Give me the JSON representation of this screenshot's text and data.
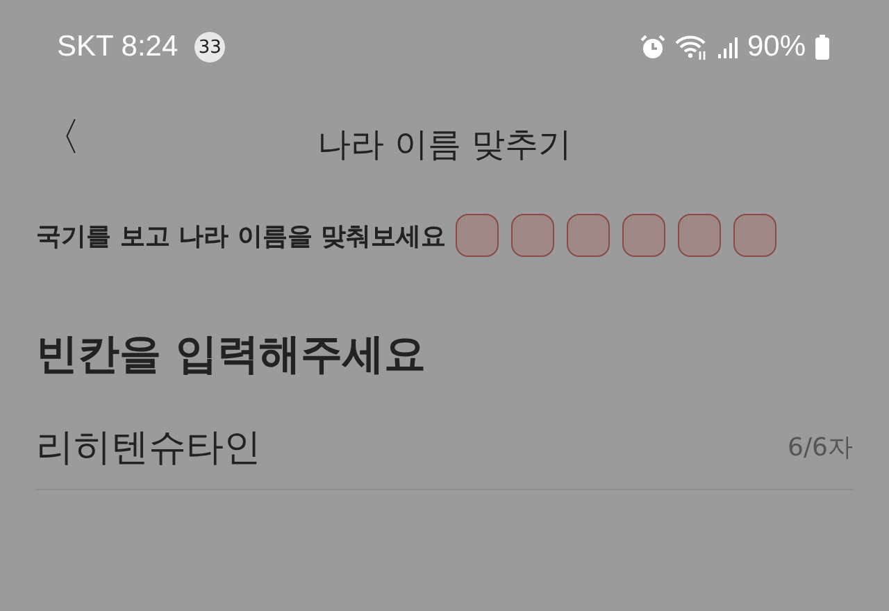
{
  "status_bar": {
    "carrier": "SKT",
    "time": "8:24",
    "notification_count": "33",
    "battery": "90%"
  },
  "header": {
    "back": "〈",
    "title": "나라 이름 맞추기"
  },
  "question": "국기를 보고 나라 이름을 맞춰보세요",
  "slots": [
    {
      "filled": false
    },
    {
      "filled": false
    },
    {
      "filled": false
    },
    {
      "filled": false
    },
    {
      "filled": false
    },
    {
      "filled": false
    }
  ],
  "prompt": "빈칸을 입력해주세요",
  "answer": {
    "value": "리히텐슈타인",
    "counter": "6/6자"
  }
}
